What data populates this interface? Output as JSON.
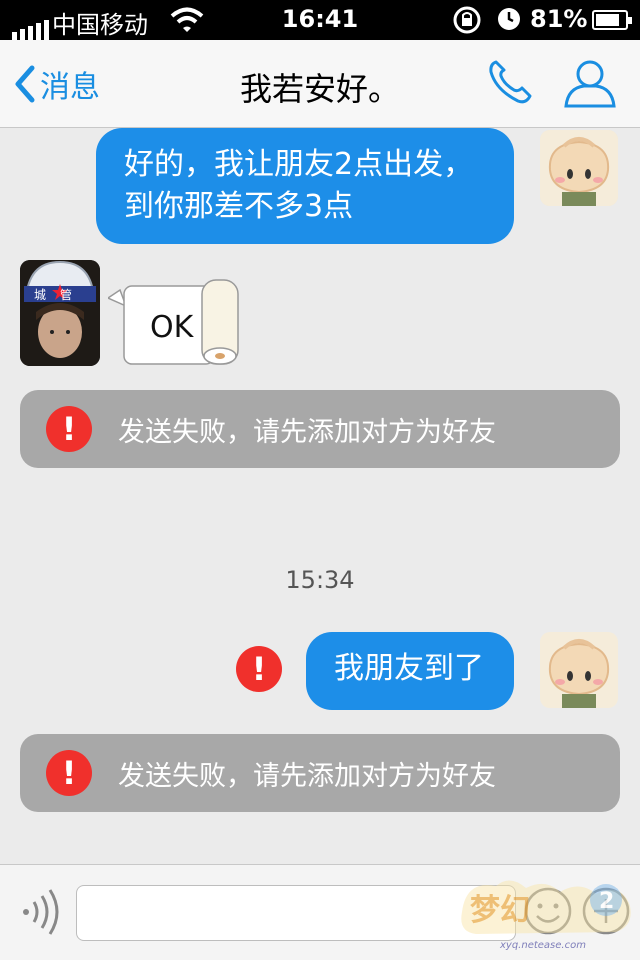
{
  "status_bar": {
    "carrier": "中国移动",
    "time": "16:41",
    "battery": "81%",
    "battery_level": 0.81,
    "icons": [
      "signal-icon",
      "wifi-icon",
      "rotation-lock-icon",
      "alarm-icon",
      "battery-charging-icon"
    ]
  },
  "nav": {
    "back_label": "消息",
    "title": "我若安好。",
    "icons": [
      "chevron-left-icon",
      "phone-icon",
      "person-icon"
    ]
  },
  "messages": [
    {
      "side": "right",
      "lines": [
        "好的，我让朋友2点出发，",
        "到你那差不多3点"
      ]
    },
    {
      "side": "left",
      "type": "sticker",
      "sticker_text": "OK",
      "avatar_label": "城管"
    },
    {
      "type": "notice",
      "text": "发送失败，请先添加对方为好友"
    },
    {
      "type": "time",
      "text": "15:34"
    },
    {
      "side": "right",
      "lines": [
        "我朋友到了"
      ],
      "failed": true,
      "fail_mark": "!"
    },
    {
      "type": "notice",
      "text": "发送失败，请先添加对方为好友"
    }
  ],
  "notice_mark": "!",
  "input_bar": {
    "placeholder": "",
    "icons": [
      "voice-icon",
      "emoji-icon",
      "plus-icon"
    ]
  },
  "watermark": {
    "url": "xyq.netease.com"
  },
  "colors": {
    "bubble_blue": "#1d8ee8",
    "error_red": "#f0302c",
    "nav_blue": "#1a8ee1",
    "notice_gray": "#a8a8a8"
  }
}
